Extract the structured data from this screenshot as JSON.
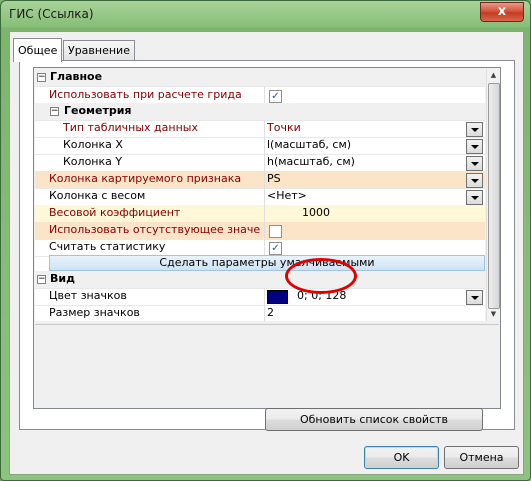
{
  "window": {
    "title": "ГИС (Ссылка)",
    "close_label": "x"
  },
  "tabs": [
    {
      "label": "Общее"
    },
    {
      "label": "Уравнение"
    }
  ],
  "grid": {
    "main_category": "Главное",
    "use_in_grid": {
      "label": "Использовать при расчете грида",
      "checked": true
    },
    "geometry_category": "Геометрия",
    "table_type": {
      "label": "Тип табличных данных",
      "value": "Точки"
    },
    "column_x": {
      "label": "Колонка X",
      "value": "l(масштаб, см)"
    },
    "column_y": {
      "label": "Колонка Y",
      "value": "h(масштаб, см)"
    },
    "mapped_column": {
      "label": "Колонка картируемого признака",
      "value": "PS"
    },
    "weight_column": {
      "label": "Колонка с весом",
      "value": "<Нет>"
    },
    "weight_coefficient": {
      "label": "Весовой коэффициент",
      "value": "1000"
    },
    "use_missing": {
      "label": "Использовать отсутствующее значение",
      "checked": false
    },
    "compute_stats": {
      "label": "Считать статистику",
      "checked": true
    },
    "make_default_label": "Сделать параметры умалчиваемыми",
    "view_category": "Вид",
    "marker_color": {
      "label": "Цвет значков",
      "value": "0; 0; 128",
      "color": "#000080"
    },
    "marker_size": {
      "label": "Размер значков",
      "value": "2"
    }
  },
  "buttons": {
    "refresh": "Обновить список свойств",
    "ok": "OK",
    "cancel": "Отмена"
  },
  "annotation": {
    "color": "#e00000"
  }
}
